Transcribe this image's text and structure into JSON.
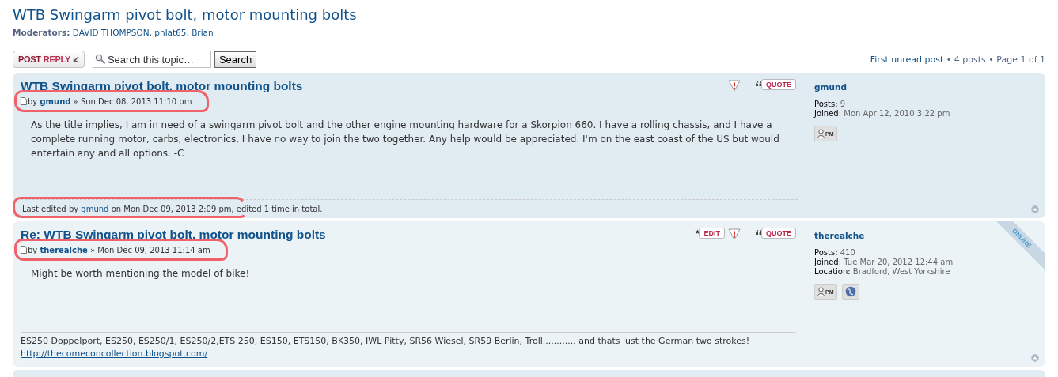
{
  "topic": {
    "title": "WTB Swingarm pivot bolt, motor mounting bolts",
    "moderators_label": "Moderators:",
    "moderators": "DAVID THOMPSON, phlat65, Brian"
  },
  "action_bar": {
    "post_reply": {
      "part1": "POST",
      "part2": "REPLY"
    },
    "search": {
      "value": "Search this topic…",
      "button": "Search"
    },
    "first_unread": "First unread post",
    "info": "• 4 posts • Page 1 of 1"
  },
  "posts": [
    {
      "title": "WTB Swingarm pivot bolt, motor mounting bolts",
      "by_label": "by",
      "author": "gmund",
      "date": "» Sun Dec 08, 2013 11:10 pm",
      "byline_marked": true,
      "buttons": [
        {
          "kind": "report"
        },
        {
          "kind": "quote",
          "label": "QUOTE"
        }
      ],
      "body": "As the title implies, I am in need of a swingarm pivot bolt and the other engine mounting hardware for a Skorpion 660. I have a rolling chassis, and I have a complete running motor, carbs, electronics, I have no way to join the two together. Any help would be appreciated. I'm on the east coast of the US but would entertain any and all options. -C",
      "edit_note": {
        "before": "Last edited by",
        "user": "gmund",
        "after": "on Mon Dec 09, 2013 2:09 pm, edited 1 time in total.",
        "marked": true
      },
      "profile": {
        "name": "gmund",
        "online": false,
        "fields": [
          {
            "label": "Posts:",
            "value": "9"
          },
          {
            "label": "Joined:",
            "value": "Mon Apr 12, 2010 3:22 pm"
          }
        ],
        "contacts": [
          {
            "kind": "pm",
            "label": "PM"
          }
        ]
      }
    },
    {
      "title": "Re: WTB Swingarm pivot bolt, motor mounting bolts",
      "by_label": "by",
      "author": "therealche",
      "date": "» Mon Dec 09, 2013 11:14 am",
      "byline_marked": true,
      "buttons": [
        {
          "kind": "edit",
          "label": "EDIT"
        },
        {
          "kind": "report"
        },
        {
          "kind": "quote",
          "label": "QUOTE"
        }
      ],
      "body": "Might be worth mentioning the model of bike!",
      "signature": {
        "text": "ES250 Doppelport, ES250, ES250/1, ES250/2,ETS 250, ES150, ETS150, BK350, IWL Pitty, SR56 Wiesel, SR59 Berlin, Troll............ and thats just the German two strokes!",
        "link": "http://thecomeconcollection.blogspot.com/"
      },
      "profile": {
        "name": "therealche",
        "online": true,
        "online_label": "ONLINE",
        "fields": [
          {
            "label": "Posts:",
            "value": "410"
          },
          {
            "label": "Joined:",
            "value": "Tue Mar 20, 2012 12:44 am"
          },
          {
            "label": "Location:",
            "value": "Bradford, West Yorkshire"
          }
        ],
        "contacts": [
          {
            "kind": "pm",
            "label": "PM"
          },
          {
            "kind": "website"
          }
        ]
      }
    }
  ]
}
